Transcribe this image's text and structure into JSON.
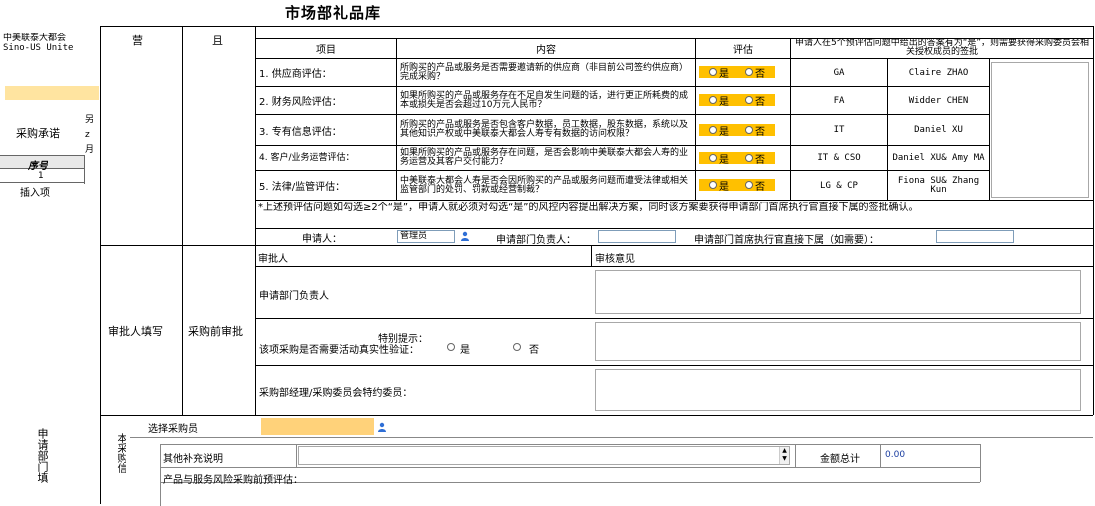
{
  "page": {
    "title": "市场部礼品库"
  },
  "left_panel": {
    "company_cn": "中美联泰大都会",
    "company_en": "Sino-US Unite",
    "section_label": "采购承诺",
    "table_header": "序号",
    "row_number": "1",
    "insert_row": "插入项",
    "side_char_1": "另",
    "side_char_2": "z",
    "side_char_3": "月",
    "bottom_side": "申请部门填"
  },
  "header_cols": {
    "col_a": "营",
    "col_b": "且"
  },
  "assessment": {
    "head_item": "项目",
    "head_content": "内容",
    "head_eval": "评估",
    "head_note": "申请人在5个预评估问题中给出的答案有为“是”，则需要获得采购委员会相关授权成员的签批",
    "yes": "是",
    "no": "否",
    "rows": [
      {
        "item": "1. 供应商评估：",
        "content": "所购买的产品或服务是否需要邀请新的供应商（非目前公司签约供应商）完成采购？",
        "dept": "GA",
        "name": "Claire ZHAO"
      },
      {
        "item": "2. 财务风险评估：",
        "content": "如果所购买的产品或服务存在不足自发生问题的话，进行更正所耗费的成本或损失是否会超过10万元人民币？",
        "dept": "FA",
        "name": "Widder CHEN"
      },
      {
        "item": "3. 专有信息评估：",
        "content": "所购买的产品或服务是否包含客户数据，员工数据，股东数据，系统以及其他知识产权或中美联泰大都会人寿专有数据的访问权限？",
        "dept": "IT",
        "name": "Daniel XU"
      },
      {
        "item": "4. 客户/业务运营评估：",
        "content": "如果所购买的产品或服务存在问题，是否会影响中美联泰大都会人寿的业务运营及其客户交付能力？",
        "dept": "IT & CSO",
        "name": "Daniel XU& Amy MA"
      },
      {
        "item": "5. 法律/监管评估：",
        "content": "中美联泰大都会人寿是否会因所购买的产品或服务问题而遭受法律或相关监管部门的处罚、罚款或经营制裁？",
        "dept": "LG & CP",
        "name": "Fiona SU& Zhang Kun"
      }
    ],
    "footnote": "*上述预评估问题如勾选≥2个“是”，申请人就必须对勾选“是”的风控内容提出解决方案，同时该方案要获得申请部门首席执行官直接下属的签批确认。",
    "applicant_label": "申请人：",
    "applicant_value": "管理员",
    "dept_head_label": "申请部门负责人：",
    "ceo_report_label": "申请部门首席执行官直接下属（如需要）："
  },
  "approval": {
    "left_label": "审批人填写",
    "mid_label": "采购前审批",
    "approver_head": "审批人",
    "opinion_head": "审核意见",
    "row1": "申请部门负责人",
    "tip_title": "特别提示：",
    "tip_question": "该项采购是否需要活动真实性验证：",
    "tip_yes": "是",
    "tip_no": "否",
    "row3": "采购部经理/采购委员会特约委员："
  },
  "buyer": {
    "label": "选择采购员"
  },
  "bottom": {
    "side_label": "本采购信",
    "other_label": "其他补充说明",
    "total_label": "金额总计",
    "total_value": "0.00",
    "risk_label": "产品与服务风险采购前预评估："
  },
  "colors": {
    "radio_bg": "#ffc000",
    "yellow_field": "#ffe4a0",
    "buyer_field": "#ffd27a",
    "total_text": "#1a3da0"
  }
}
